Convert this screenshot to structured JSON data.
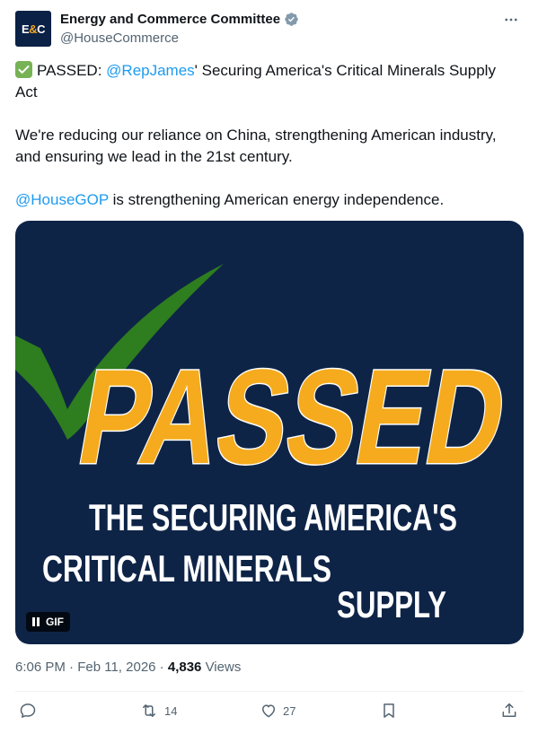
{
  "author": {
    "avatar_text": "E&C",
    "display_name": "Energy and Commerce Committee",
    "handle": "@HouseCommerce",
    "verified_icon": "verified-badge-icon"
  },
  "tweet": {
    "passed_emoji": "check-mark-box-icon",
    "line1_prefix": "PASSED: ",
    "line1_mention": "@RepJames",
    "line1_suffix": "' Securing America's Critical Minerals Supply Act",
    "para2": "We're reducing our reliance on China, strengthening American industry, and ensuring we lead in the 21st century.",
    "para3_mention": "@HouseGOP",
    "para3_suffix": " is strengthening American energy independence."
  },
  "media": {
    "headline": "PASSED",
    "line1": "THE SECURING AMERICA'S",
    "line2": "CRITICAL MINERALS",
    "line3": "SUPPLY",
    "gif_label": "GIF",
    "colors": {
      "background": "#0e2447",
      "headline": "#f5ab1d",
      "check": "#2e7d1f",
      "text": "#ffffff"
    }
  },
  "meta": {
    "time": "6:06 PM",
    "sep1": " · ",
    "date": "Feb 11, 2026",
    "sep2": " · ",
    "views_count": "4,836",
    "views_label": " Views"
  },
  "actions": {
    "reply_count": "",
    "retweet_count": "14",
    "like_count": "27"
  },
  "colors": {
    "link": "#1d9bf0",
    "muted": "#536471",
    "text": "#0f1419"
  }
}
